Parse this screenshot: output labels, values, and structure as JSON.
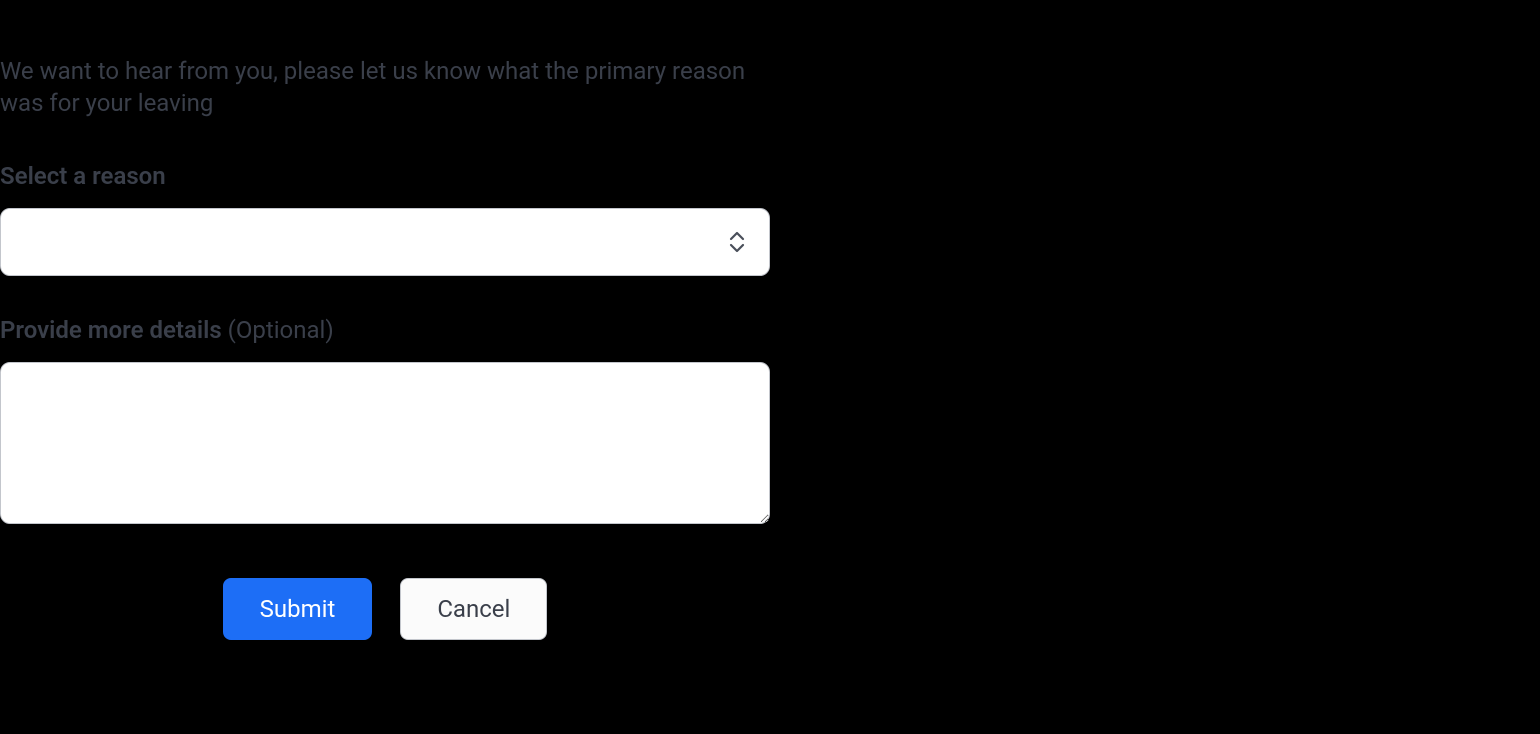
{
  "form": {
    "intro": "We want to hear from you, please let us know what the primary reason was for your leaving",
    "reason": {
      "label": "Select a reason",
      "value": ""
    },
    "details": {
      "label": "Provide more details",
      "optional": "(Optional)",
      "value": ""
    },
    "buttons": {
      "submit": "Submit",
      "cancel": "Cancel"
    }
  }
}
